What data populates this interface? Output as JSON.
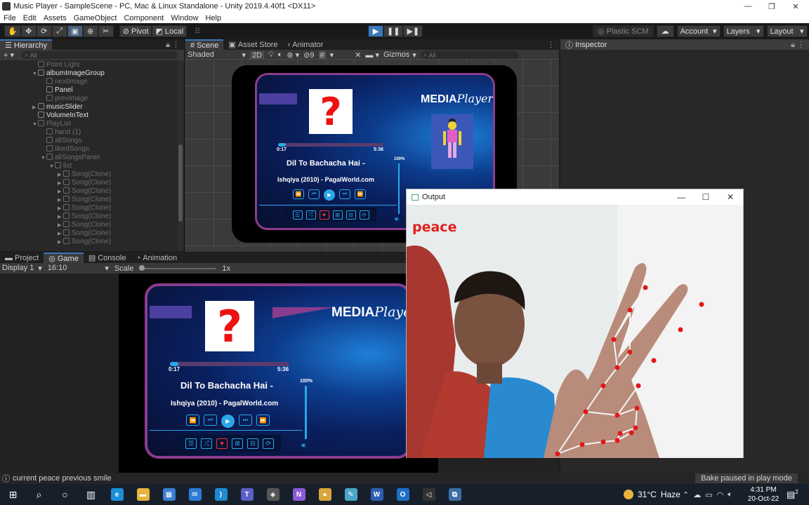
{
  "window": {
    "title": "Music Player - SampleScene - PC, Mac & Linux Standalone - Unity 2019.4.40f1 <DX11>",
    "controls": {
      "minimize": "—",
      "maximize": "❐",
      "close": "✕"
    }
  },
  "menu": [
    "File",
    "Edit",
    "Assets",
    "GameObject",
    "Component",
    "Window",
    "Help"
  ],
  "toolbar": {
    "pivot_label": "Pivot",
    "local_label": "Local",
    "plastic_label": "Plastic SCM",
    "account_label": "Account",
    "layers_label": "Layers",
    "layout_label": "Layout"
  },
  "hierarchy": {
    "tab_label": "Hierarchy",
    "search_placeholder": "All",
    "items": [
      {
        "label": "Point Light",
        "depth": 2,
        "arrow": "",
        "style": "dim"
      },
      {
        "label": "albumImageGroup",
        "depth": 2,
        "arrow": "▼",
        "style": "bright"
      },
      {
        "label": "nextImage",
        "depth": 3,
        "arrow": "",
        "style": "dim"
      },
      {
        "label": "Panel",
        "depth": 3,
        "arrow": "",
        "style": "bright"
      },
      {
        "label": "prevImage",
        "depth": 3,
        "arrow": "",
        "style": "dim"
      },
      {
        "label": "musicSlider",
        "depth": 2,
        "arrow": "▶",
        "style": "bright"
      },
      {
        "label": "VolumeInText",
        "depth": 2,
        "arrow": "",
        "style": "bright"
      },
      {
        "label": "PlayList",
        "depth": 2,
        "arrow": "▼",
        "style": "dim"
      },
      {
        "label": "hand (1)",
        "depth": 3,
        "arrow": "",
        "style": "dim"
      },
      {
        "label": "allSongs",
        "depth": 3,
        "arrow": "",
        "style": "dim"
      },
      {
        "label": "likedSongs",
        "depth": 3,
        "arrow": "",
        "style": "dim"
      },
      {
        "label": "allSongsPanel",
        "depth": 3,
        "arrow": "▼",
        "style": "dim"
      },
      {
        "label": "list",
        "depth": 4,
        "arrow": "▼",
        "style": "dim"
      },
      {
        "label": "Song(Clone)",
        "depth": 5,
        "arrow": "▶",
        "style": "dim"
      },
      {
        "label": "Song(Clone)",
        "depth": 5,
        "arrow": "▶",
        "style": "dim"
      },
      {
        "label": "Song(Clone)",
        "depth": 5,
        "arrow": "▶",
        "style": "dim"
      },
      {
        "label": "Song(Clone)",
        "depth": 5,
        "arrow": "▶",
        "style": "dim"
      },
      {
        "label": "Song(Clone)",
        "depth": 5,
        "arrow": "▶",
        "style": "dim"
      },
      {
        "label": "Song(Clone)",
        "depth": 5,
        "arrow": "▶",
        "style": "dim"
      },
      {
        "label": "Song(Clone)",
        "depth": 5,
        "arrow": "▶",
        "style": "dim"
      },
      {
        "label": "Song(Clone)",
        "depth": 5,
        "arrow": "▶",
        "style": "dim"
      },
      {
        "label": "Song(Clone)",
        "depth": 5,
        "arrow": "▶",
        "style": "dim"
      }
    ]
  },
  "scene": {
    "tabs": [
      {
        "icon": "#",
        "label": "Scene"
      },
      {
        "icon": "▣",
        "label": "Asset Store"
      },
      {
        "icon": "›",
        "label": "Animator"
      }
    ],
    "shading_mode": "Shaded",
    "toggle_2d": "2D",
    "hidden_count": "9",
    "gizmos_label": "Gizmos",
    "search_placeholder": "All"
  },
  "inspector": {
    "tab_label": "Inspector"
  },
  "bottom_tabs": [
    {
      "icon": "▬",
      "label": "Project"
    },
    {
      "icon": "◎",
      "label": "Game"
    },
    {
      "icon": "▤",
      "label": "Console"
    },
    {
      "icon": "◔",
      "label": "Animation"
    }
  ],
  "game": {
    "display": "Display 1",
    "aspect": "16:10",
    "scale_label": "Scale",
    "scale_value": "1x"
  },
  "player": {
    "brand_bold": "MEDIA",
    "brand_italic": "Player",
    "time_current": "0:17",
    "time_total": "5:36",
    "progress": 0.07,
    "song_title": "Dil To Bachacha Hai -",
    "song_album": "Ishqiya (2010) - PagalWorld.com",
    "volume_label": "100%",
    "album_art_glyph": "?",
    "controls": [
      "⏪",
      "⏮",
      "▶",
      "⏭",
      "⏩"
    ],
    "bottom_buttons": [
      "☰",
      "⤮",
      "♥",
      "⊞",
      "⊟",
      "⟳"
    ]
  },
  "output_window": {
    "title": "Output",
    "gesture_label": "peace"
  },
  "status": {
    "message": "current peace previous smile",
    "right_message": "Bake paused in play mode"
  },
  "taskbar": {
    "weather_temp": "31°C",
    "weather_desc": "Haze",
    "time": "4:31 PM",
    "date": "20-Oct-22",
    "notification_count": "2",
    "apps": [
      {
        "name": "edge",
        "glyph": "e",
        "color": "#1a8fd8"
      },
      {
        "name": "file-explorer",
        "glyph": "▬",
        "color": "#e8b33c"
      },
      {
        "name": "store",
        "glyph": "▦",
        "color": "#3a7fd4"
      },
      {
        "name": "mail",
        "glyph": "✉",
        "color": "#2d7bd6"
      },
      {
        "name": "vscode",
        "glyph": "⟩",
        "color": "#1f8ad2"
      },
      {
        "name": "teams",
        "glyph": "T",
        "color": "#5b5fc7"
      },
      {
        "name": "unity-hub",
        "glyph": "◈",
        "color": "#555"
      },
      {
        "name": "visual-studio",
        "glyph": "N",
        "color": "#8a5bd6"
      },
      {
        "name": "chrome",
        "glyph": "●",
        "color": "#d9a53a"
      },
      {
        "name": "notes",
        "glyph": "✎",
        "color": "#4aa7c7"
      },
      {
        "name": "word",
        "glyph": "W",
        "color": "#2b5fb4"
      },
      {
        "name": "outlook",
        "glyph": "O",
        "color": "#1f6fc7"
      },
      {
        "name": "unity",
        "glyph": "◁",
        "color": "#333"
      },
      {
        "name": "python",
        "glyph": "⧉",
        "color": "#3b6ea8"
      }
    ]
  }
}
